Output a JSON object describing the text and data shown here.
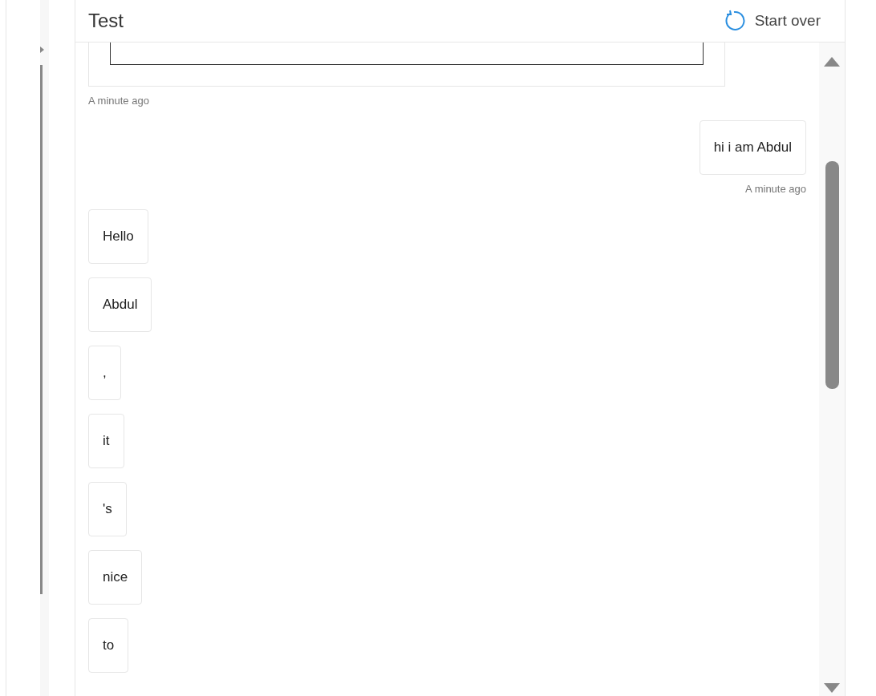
{
  "header": {
    "title": "Test",
    "start_over": "Start over"
  },
  "messages": [
    {
      "kind": "card",
      "timestamp": "A minute ago"
    },
    {
      "kind": "user",
      "text": "hi i am Abdul",
      "timestamp": "A minute ago"
    },
    {
      "kind": "bot",
      "text": "Hello"
    },
    {
      "kind": "bot",
      "text": "Abdul"
    },
    {
      "kind": "bot",
      "text": ","
    },
    {
      "kind": "bot",
      "text": "it"
    },
    {
      "kind": "bot",
      "text": "'s"
    },
    {
      "kind": "bot",
      "text": "nice"
    },
    {
      "kind": "bot",
      "text": "to"
    }
  ]
}
